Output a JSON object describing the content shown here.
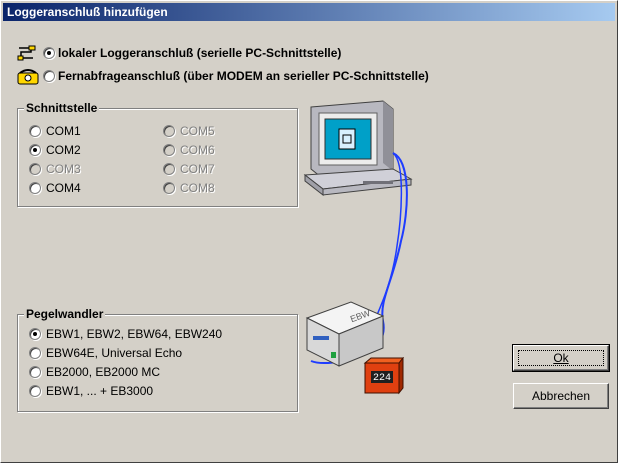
{
  "window": {
    "title": "Loggeranschluß hinzufügen"
  },
  "connection": {
    "local_label": "lokaler Loggeranschluß (serielle PC-Schnittstelle)",
    "remote_label": "Fernabfrageanschluß (über MODEM an serieller PC-Schnittstelle)",
    "selected": "local"
  },
  "interface": {
    "title": "Schnittstelle",
    "ports": [
      {
        "label": "COM1",
        "enabled": true,
        "checked": false
      },
      {
        "label": "COM2",
        "enabled": true,
        "checked": true
      },
      {
        "label": "COM3",
        "enabled": false,
        "checked": false
      },
      {
        "label": "COM4",
        "enabled": true,
        "checked": false
      },
      {
        "label": "COM5",
        "enabled": false,
        "checked": false
      },
      {
        "label": "COM6",
        "enabled": false,
        "checked": false
      },
      {
        "label": "COM7",
        "enabled": false,
        "checked": false
      },
      {
        "label": "COM8",
        "enabled": false,
        "checked": false
      }
    ]
  },
  "converter": {
    "title": "Pegelwandler",
    "options": [
      {
        "label": "EBW1, EBW2, EBW64, EBW240",
        "checked": true
      },
      {
        "label": "EBW64E, Universal Echo",
        "checked": false
      },
      {
        "label": "EB2000, EB2000 MC",
        "checked": false
      },
      {
        "label": "EBW1, ... + EB3000",
        "checked": false
      }
    ]
  },
  "device": {
    "display": "224",
    "label": "EBW"
  },
  "buttons": {
    "ok": "Ok",
    "cancel": "Abbrechen"
  },
  "colors": {
    "title_start": "#0a246a",
    "title_end": "#a6caf0",
    "dialog_bg": "#d4d0c8",
    "cable": "#1e3cff",
    "monitor_screen": "#00a0c8",
    "gauge": "#e04010"
  }
}
